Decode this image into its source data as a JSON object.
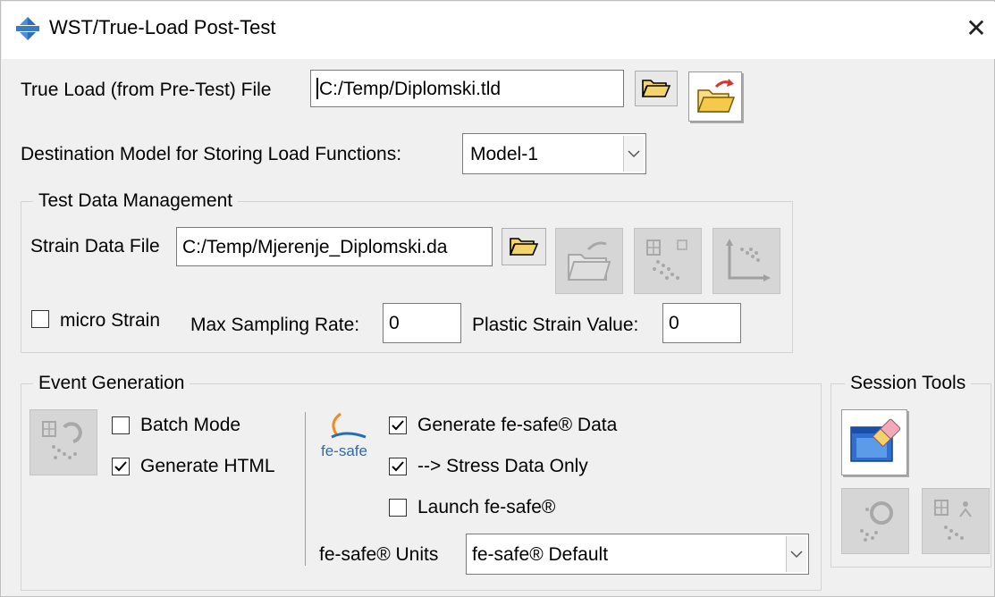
{
  "window": {
    "title": "WST/True-Load Post-Test",
    "close_icon": "close-icon",
    "app_icon": "diamond-app-icon"
  },
  "true_load": {
    "label": "True Load (from Pre-Test) File",
    "value": "C:/Temp/Diplomski.tld",
    "browse_icon": "folder-open-icon",
    "import_icon": "folder-import-icon"
  },
  "destination": {
    "label": "Destination Model for Storing Load Functions:",
    "selected": "Model-1"
  },
  "test_data": {
    "title": "Test Data Management",
    "strain_label": "Strain Data File",
    "strain_value": "C:/Temp/Mjerenje_Diplomski.da",
    "micro_strain_label": "micro Strain",
    "micro_strain_checked": false,
    "max_sampling_label": "Max Sampling Rate:",
    "max_sampling_value": "0",
    "plastic_label": "Plastic Strain Value:",
    "plastic_value": "0"
  },
  "event_generation": {
    "title": "Event Generation",
    "batch_mode_label": "Batch Mode",
    "batch_mode_checked": false,
    "generate_html_label": "Generate HTML",
    "generate_html_checked": true,
    "fesafe_logo_text": "fe-safe",
    "generate_fesafe_label": "Generate fe-safe® Data",
    "generate_fesafe_checked": true,
    "stress_only_label": "--> Stress Data Only",
    "stress_only_checked": true,
    "launch_label": "Launch fe-safe®",
    "launch_checked": false,
    "units_label": "fe-safe® Units",
    "units_selected": "fe-safe® Default"
  },
  "session_tools": {
    "title": "Session Tools"
  },
  "colors": {
    "title_bg": "#ffffff",
    "dialog_bg": "#f0f0f0",
    "folder_yellow": "#f5d36b",
    "accent_red": "#d9342b",
    "fesafe_blue": "#2b6cb0"
  }
}
